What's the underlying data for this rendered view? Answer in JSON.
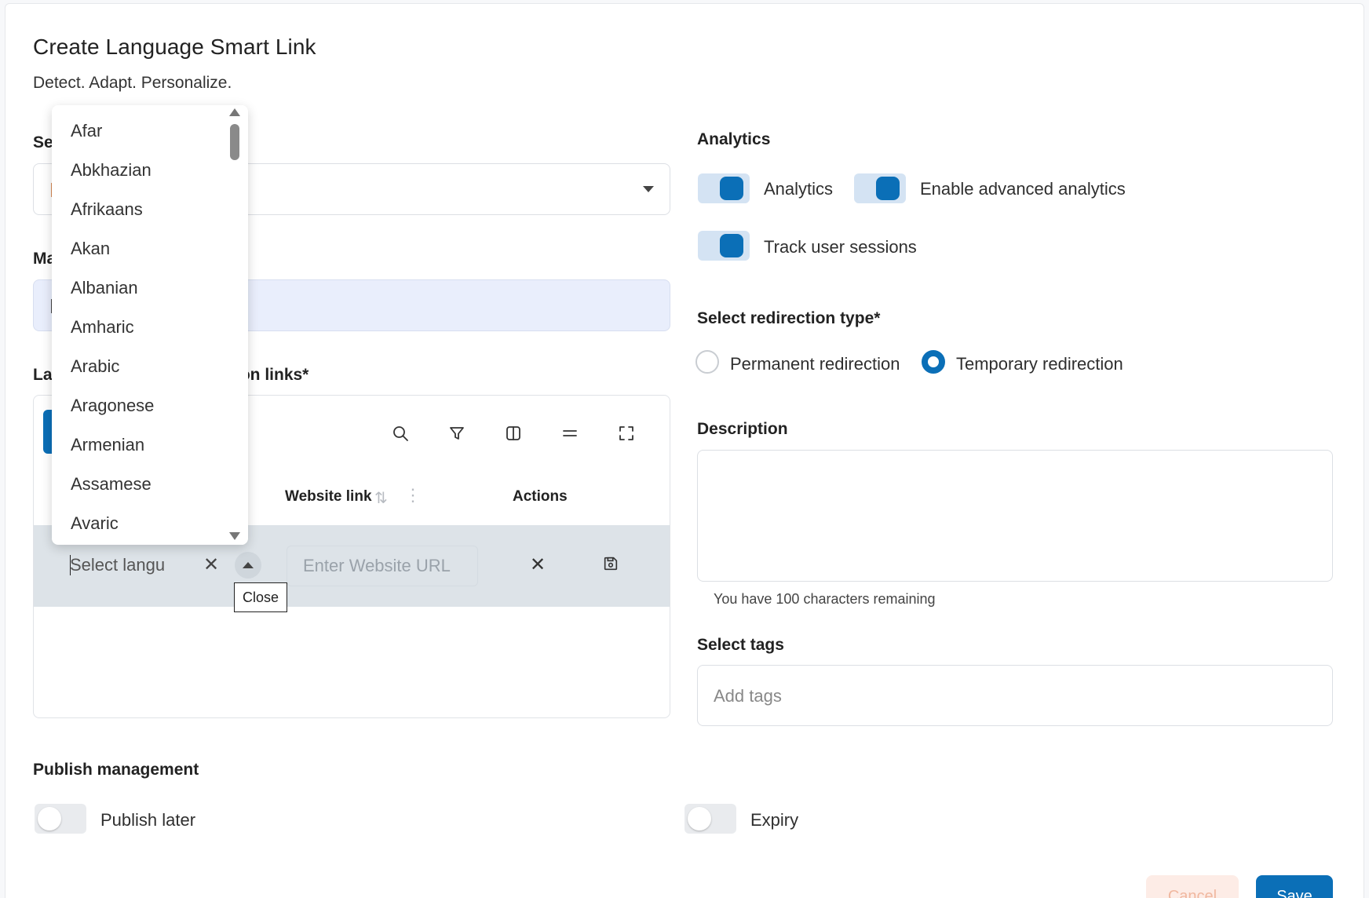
{
  "header": {
    "title": "Create Language Smart Link",
    "subtitle": "Detect. Adapt. Personalize."
  },
  "left": {
    "select_label_partial": "Se",
    "input_label_partial": "Ma",
    "table_label_prefix": "La",
    "table_label_suffix": "ion links*"
  },
  "table": {
    "toolbar_icons": [
      "search-icon",
      "filter-icon",
      "columns-icon",
      "density-icon",
      "fullscreen-icon"
    ],
    "columns": {
      "website_link": "Website link",
      "actions": "Actions"
    },
    "edit_row": {
      "language_placeholder": "Select langu",
      "url_placeholder": "Enter Website URL"
    },
    "tooltip": "Close"
  },
  "dropdown": {
    "options": [
      "Afar",
      "Abkhazian",
      "Afrikaans",
      "Akan",
      "Albanian",
      "Amharic",
      "Arabic",
      "Aragonese",
      "Armenian",
      "Assamese",
      "Avaric"
    ]
  },
  "analytics": {
    "heading": "Analytics",
    "toggles": [
      {
        "label": "Analytics",
        "on": true
      },
      {
        "label": "Enable advanced analytics",
        "on": true
      },
      {
        "label": "Track user sessions",
        "on": true
      }
    ]
  },
  "redirection": {
    "heading": "Select redirection type*",
    "options": [
      {
        "label": "Permanent redirection",
        "selected": false
      },
      {
        "label": "Temporary redirection",
        "selected": true
      }
    ]
  },
  "description": {
    "heading": "Description",
    "value": "",
    "hint": "You have 100 characters remaining"
  },
  "tags": {
    "heading": "Select tags",
    "placeholder": "Add tags"
  },
  "publish": {
    "heading": "Publish management",
    "toggles": [
      {
        "label": "Publish later",
        "on": false
      },
      {
        "label": "Expiry",
        "on": false
      }
    ]
  },
  "footer": {
    "cancel_label": "Cancel",
    "save_label": "Save"
  },
  "colors": {
    "accent": "#0b6fb7",
    "edit_row_bg": "#dde3e8",
    "input_bg": "#e9eefc"
  }
}
